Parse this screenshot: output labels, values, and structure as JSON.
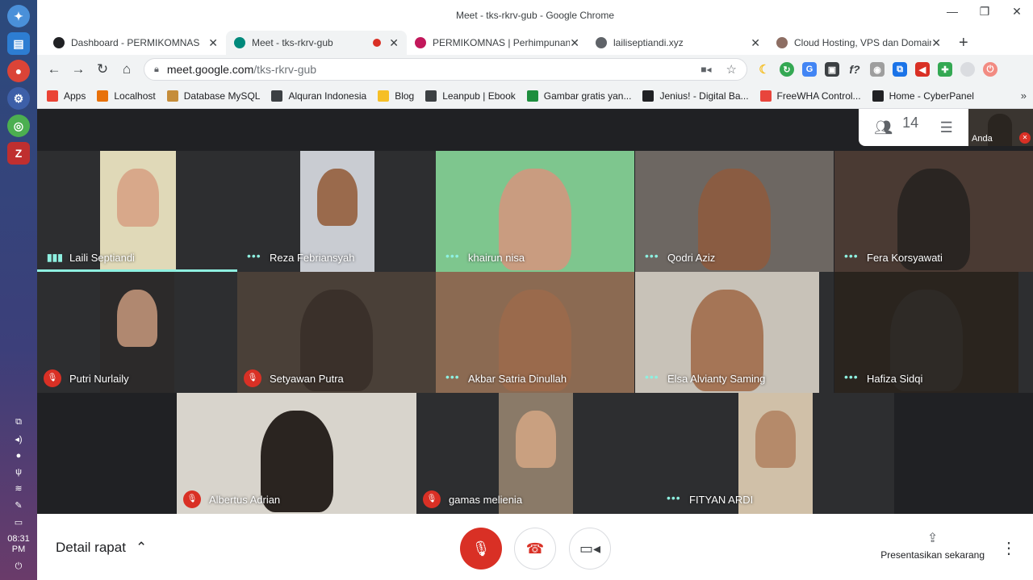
{
  "window": {
    "title": "Meet - tks-rkrv-gub - Google Chrome"
  },
  "tabs": [
    {
      "label": "Dashboard - PERMIKOMNAS",
      "color": "#202124"
    },
    {
      "label": "Meet - tks-rkrv-gub",
      "color": "#00897b",
      "recording": true
    },
    {
      "label": "PERMIKOMNAS | Perhimpunan",
      "color": "#c2185b"
    },
    {
      "label": "lailiseptiandi.xyz",
      "color": "#5f6368"
    },
    {
      "label": "Cloud Hosting, VPS dan Domain",
      "color": "#8d6e63"
    }
  ],
  "address": {
    "host": "meet.google.com",
    "path": "/tks-rkrv-gub"
  },
  "bookmarks": [
    {
      "label": "Apps",
      "color": "#ea4335"
    },
    {
      "label": "Localhost",
      "color": "#e8710a"
    },
    {
      "label": "Database MySQL",
      "color": "#c58d3a"
    },
    {
      "label": "Alquran Indonesia",
      "color": "#3c4043"
    },
    {
      "label": "Blog",
      "color": "#f6bf26"
    },
    {
      "label": "Leanpub | Ebook",
      "color": "#3c4043"
    },
    {
      "label": "Gambar gratis yan...",
      "color": "#1e8e3e"
    },
    {
      "label": "Jenius! - Digital Ba...",
      "color": "#202124"
    },
    {
      "label": "FreeWHA Control...",
      "color": "#e8453c"
    },
    {
      "label": "Home - CyberPanel",
      "color": "#202124"
    }
  ],
  "meet": {
    "participant_count": "14",
    "self_label": "Anda",
    "participants": [
      {
        "name": "Laili Septiandi",
        "status": "speaking",
        "bg": "#e0d9b8",
        "skin": "#d8a88a"
      },
      {
        "name": "Reza Febriansyah",
        "status": "dots",
        "bg": "#c9ccd2",
        "skin": "#9a6a4c"
      },
      {
        "name": "khairun nisa",
        "status": "dots",
        "bg": "#7ec68e",
        "skin": "#c99c80"
      },
      {
        "name": "Qodri Aziz",
        "status": "dots",
        "bg": "#6d6762",
        "skin": "#8a5c42"
      },
      {
        "name": "Fera Korsyawati",
        "status": "dots",
        "bg": "#4a3a33",
        "skin": "#2a2522"
      },
      {
        "name": "Putri Nurlaily",
        "status": "muted",
        "bg": "#2c2a2a",
        "skin": "#b08870"
      },
      {
        "name": "Setyawan Putra",
        "status": "muted",
        "bg": "#4a4038",
        "skin": "#3a302a"
      },
      {
        "name": "Akbar Satria Dinullah",
        "status": "dots",
        "bg": "#8b6a52",
        "skin": "#9a6a4c"
      },
      {
        "name": "Elsa Alvianty Saming",
        "status": "dots",
        "bg": "#c8c2b8",
        "skin": "#a57556"
      },
      {
        "name": "Hafiza Sidqi",
        "status": "dots",
        "bg": "#2a241e",
        "skin": "#2e2a26"
      },
      {
        "name": "Albertus Adrian",
        "status": "muted",
        "bg": "#d8d4cc",
        "skin": "#2a2420"
      },
      {
        "name": "gamas melienia",
        "status": "muted",
        "bg": "#8a7a68",
        "skin": "#c9a080"
      },
      {
        "name": "FITYAN ARDI",
        "status": "dots",
        "bg": "#d0c0a8",
        "skin": "#b58a6a"
      }
    ]
  },
  "bottom": {
    "detail_label": "Detail rapat",
    "present_label": "Presentasikan sekarang",
    "mic_color": "#d93025"
  },
  "os": {
    "time": "08:31",
    "ampm": "PM"
  }
}
